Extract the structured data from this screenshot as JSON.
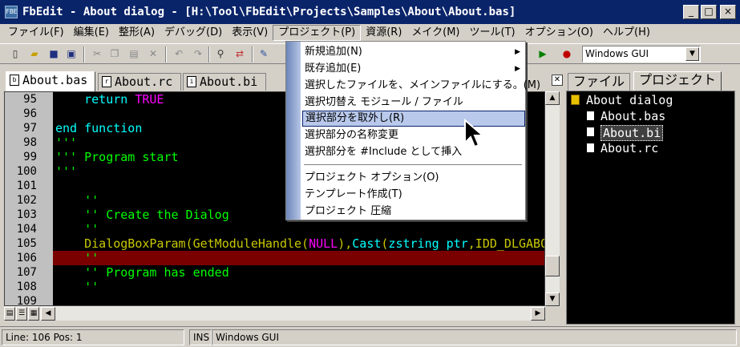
{
  "window": {
    "title": "FbEdit - About dialog - [H:\\Tool\\FbEdit\\Projects\\Samples\\About\\About.bas]",
    "app_icon_text": "FBE",
    "min_label": "_",
    "max_label": "□",
    "close_label": "×"
  },
  "menubar": {
    "items": [
      "ファイル(F)",
      "編集(E)",
      "整形(A)",
      "デバッグ(D)",
      "表示(V)",
      "プロジェクト(P)",
      "資源(R)",
      "メイク(M)",
      "ツール(T)",
      "オプション(O)",
      "ヘルプ(H)"
    ]
  },
  "toolbar": {
    "build_target": "Windows GUI",
    "icons": [
      "new-file-icon",
      "open-folder-icon",
      "save-icon",
      "save-all-icon",
      "cut-icon",
      "copy-icon",
      "paste-icon",
      "delete-icon",
      "undo-icon",
      "redo-icon",
      "find-icon",
      "replace-icon",
      "run-icon",
      "color-icon"
    ]
  },
  "tabs": [
    {
      "label": "About.bas",
      "icon": "b"
    },
    {
      "label": "About.rc",
      "icon": "r"
    },
    {
      "label": "About.bi",
      "icon": "i"
    }
  ],
  "editor": {
    "line_numbers": [
      "95",
      "96",
      "97",
      "98",
      "99",
      "100",
      "101",
      "102",
      "103",
      "104",
      "105",
      "106",
      "107",
      "108",
      "109"
    ],
    "lines": [
      {
        "text": "    return TRUE",
        "parts": [
          {
            "t": "    return ",
            "c": "kw"
          },
          {
            "t": "TRUE",
            "c": "cs"
          }
        ]
      },
      {
        "text": "",
        "parts": []
      },
      {
        "text": "end function",
        "parts": [
          {
            "t": "end function",
            "c": "kw"
          }
        ]
      },
      {
        "text": "'''",
        "parts": [
          {
            "t": "'''",
            "c": "cm"
          }
        ]
      },
      {
        "text": "''' Program start",
        "parts": [
          {
            "t": "''' Program start",
            "c": "cm"
          }
        ]
      },
      {
        "text": "'''",
        "parts": [
          {
            "t": "'''",
            "c": "cm"
          }
        ]
      },
      {
        "text": "",
        "parts": []
      },
      {
        "text": "    ''",
        "parts": [
          {
            "t": "    ''",
            "c": "cm"
          }
        ]
      },
      {
        "text": "    '' Create the Dialog",
        "parts": [
          {
            "t": "    '' Create the Dialog",
            "c": "cm"
          }
        ]
      },
      {
        "text": "    ''",
        "parts": [
          {
            "t": "    ''",
            "c": "cm"
          }
        ]
      },
      {
        "text": "    DialogBoxParam(GetModuleHandle(NULL),Cast(zstring ptr,IDD_DLGABOU",
        "parts": [
          {
            "t": "    DialogBoxParam(GetModuleHandle(",
            "c": "ty"
          },
          {
            "t": "NULL",
            "c": "cs"
          },
          {
            "t": "),",
            "c": "ty"
          },
          {
            "t": "Cast",
            "c": "kw"
          },
          {
            "t": "(",
            "c": "ty"
          },
          {
            "t": "zstring ptr",
            "c": "kw"
          },
          {
            "t": ",IDD_DLGABOU",
            "c": "ty"
          }
        ]
      },
      {
        "text": "    ''",
        "parts": [
          {
            "t": "    ''",
            "c": "cm"
          }
        ]
      },
      {
        "text": "    '' Program has ended",
        "parts": [
          {
            "t": "    '' Program has ended",
            "c": "cm"
          }
        ]
      },
      {
        "text": "    ''",
        "parts": [
          {
            "t": "    ''",
            "c": "cm"
          }
        ]
      }
    ]
  },
  "project_panel": {
    "tab_file": "ファイル",
    "tab_project": "プロジェクト",
    "root": "About dialog",
    "files": [
      "About.bas",
      "About.bi",
      "About.rc"
    ],
    "selected": "About.bi"
  },
  "dropdown": {
    "items": [
      {
        "label": "新規追加(N)",
        "submenu": true
      },
      {
        "label": "既存追加(E)",
        "submenu": true
      },
      {
        "label": "選択したファイルを、メインファイルにする。(M)",
        "submenu": false
      },
      {
        "label": "選択切替え モジュール / ファイル",
        "submenu": false
      },
      {
        "label": "選択部分を取外し(R)",
        "submenu": false,
        "selected": true
      },
      {
        "label": "選択部分の名称変更",
        "submenu": false
      },
      {
        "label": "選択部分を #Include として挿入",
        "submenu": false
      },
      {
        "label": "プロジェクト オプション(O)",
        "submenu": false
      },
      {
        "label": "テンプレート作成(T)",
        "submenu": false
      },
      {
        "label": "プロジェクト 圧縮",
        "submenu": false
      }
    ]
  },
  "statusbar": {
    "position": "Line: 106 Pos: 1",
    "mode": "INS",
    "target": "Windows GUI"
  }
}
